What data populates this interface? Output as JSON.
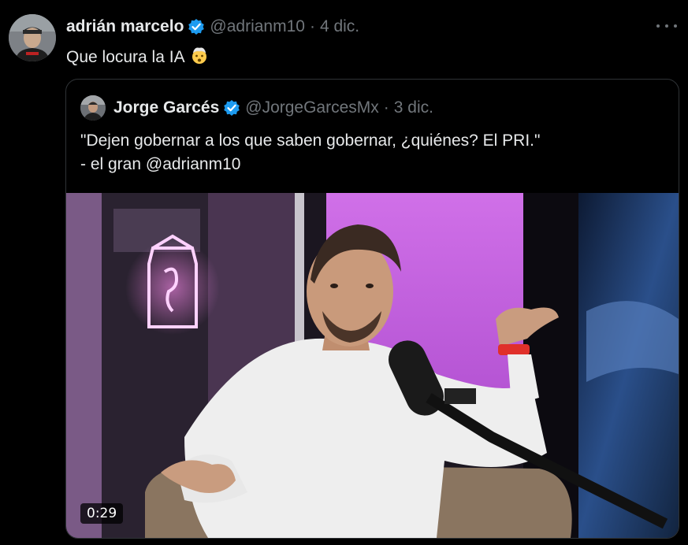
{
  "tweet": {
    "author_name": "adrián marcelo",
    "author_handle": "@adrianm10",
    "separator": "·",
    "time": "4 dic.",
    "text": "Que locura la IA",
    "emoji_icon": "exploding-head-emoji"
  },
  "quoted_tweet": {
    "author_name": "Jorge Garcés",
    "author_handle": "@JorgeGarcesMx",
    "separator": "·",
    "time": "3 dic.",
    "text": "\"Dejen gobernar a los que saben gobernar, ¿quiénes? El PRI.\"\n- el gran @adrianm10",
    "video_duration": "0:29"
  },
  "colors": {
    "background": "#000000",
    "text": "#e7e9ea",
    "muted": "#71767b",
    "verified": "#1d9bf0",
    "border": "#2f3336"
  }
}
